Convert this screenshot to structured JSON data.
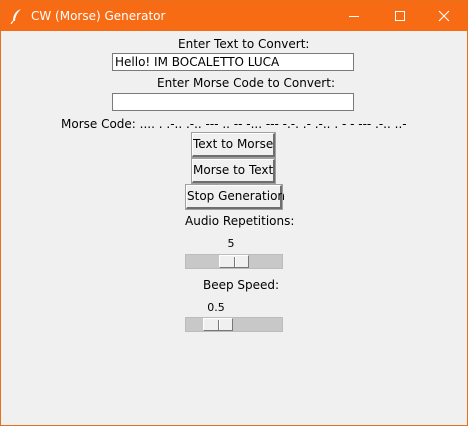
{
  "window": {
    "title": "CW (Morse) Generator",
    "accent_color": "#f76b15",
    "icon": "feather-icon"
  },
  "text_input": {
    "label": "Enter Text to Convert:",
    "value": "Hello! IM BOCALETTO LUCA"
  },
  "morse_input": {
    "label": "Enter Morse Code to Convert:",
    "value": ""
  },
  "morse_output": {
    "label": "Morse Code:",
    "value": ".... . .-.. .-.. --- .. -- -... --- -.-. .- .-.. . - - --- .-.. ..- -.-. .-"
  },
  "buttons": {
    "text_to_morse": "Text to Morse",
    "morse_to_text": "Morse to Text",
    "stop_generation": "Stop Generation"
  },
  "repetitions": {
    "label": "Audio Repetitions:",
    "value": "5",
    "level_fraction": 0.5
  },
  "beep_speed": {
    "label": "Beep Speed:",
    "value": "0.5",
    "level_fraction": 0.25
  }
}
